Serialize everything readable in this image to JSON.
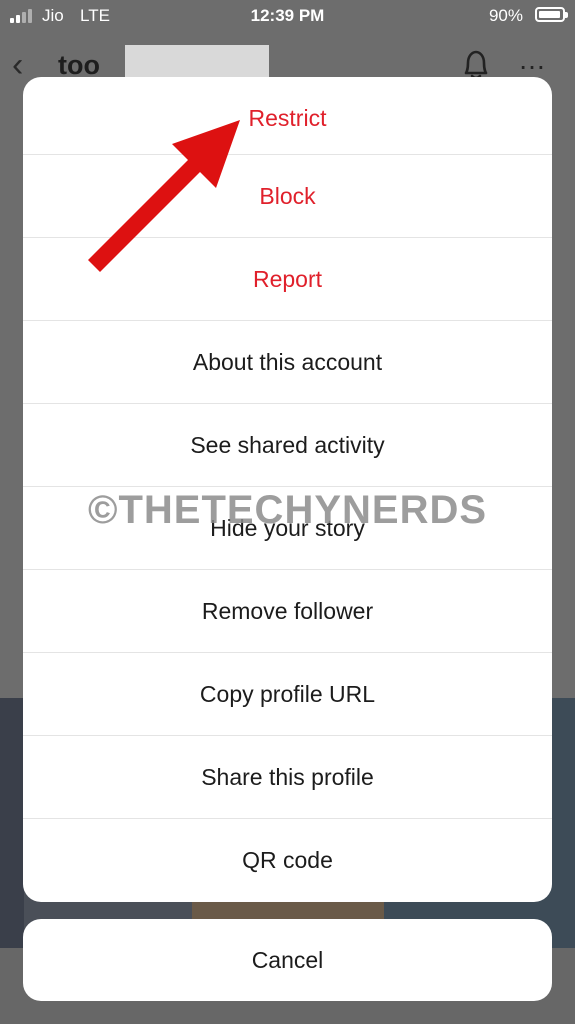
{
  "status_bar": {
    "carrier": "Jio",
    "network": "LTE",
    "time": "12:39 PM",
    "battery": "90%"
  },
  "header": {
    "username": "too"
  },
  "action_sheet": {
    "items": [
      {
        "label": "Restrict",
        "style": "danger"
      },
      {
        "label": "Block",
        "style": "danger"
      },
      {
        "label": "Report",
        "style": "danger"
      },
      {
        "label": "About this account",
        "style": "default"
      },
      {
        "label": "See shared activity",
        "style": "default"
      },
      {
        "label": "Hide your story",
        "style": "default"
      },
      {
        "label": "Remove follower",
        "style": "default"
      },
      {
        "label": "Copy profile URL",
        "style": "default"
      },
      {
        "label": "Share this profile",
        "style": "default"
      },
      {
        "label": "QR code",
        "style": "default"
      }
    ],
    "cancel_label": "Cancel"
  },
  "watermark": "©THETECHYNERDS",
  "colors": {
    "danger": "#e0202b",
    "arrow": "#dd1111",
    "overlay": "#6d6d6d"
  }
}
